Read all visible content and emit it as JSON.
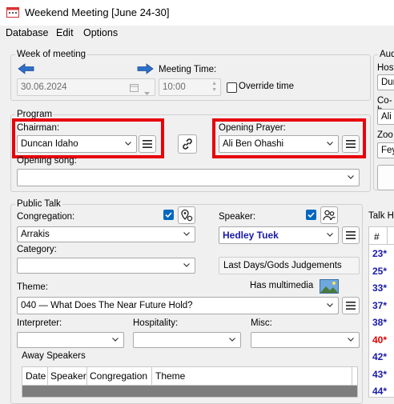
{
  "window": {
    "title": "Weekend Meeting [June 24-30]"
  },
  "menu": [
    "Database",
    "Edit",
    "Options"
  ],
  "week": {
    "group_label": "Week of meeting",
    "date_value": "30.06.2024",
    "meeting_time_label": "Meeting Time:",
    "meeting_time_value": "10:00",
    "override_label": "Override time"
  },
  "audio": {
    "group_label": "Aud",
    "host_label": "Host",
    "host_value": "Dun",
    "cohost_label": "Co-h",
    "cohost_value": "Ali",
    "zoom_label": "Zoo",
    "zoom_value": "Fey"
  },
  "program": {
    "group_label": "Program",
    "chairman_label": "Chairman:",
    "chairman_value": "Duncan Idaho",
    "opening_prayer_label": "Opening Prayer:",
    "opening_prayer_value": "Ali Ben Ohashi",
    "opening_song_label": "Opening song:",
    "opening_song_value": ""
  },
  "public_talk": {
    "group_label": "Public Talk",
    "congregation_label": "Congregation:",
    "congregation_value": "Arrakis",
    "category_label": "Category:",
    "category_value": "",
    "speaker_label": "Speaker:",
    "speaker_value": "Hedley Tuek",
    "talk_category_display": "Last Days/Gods Judgements",
    "theme_label": "Theme:",
    "has_multimedia_label": "Has multimedia",
    "theme_value": "040 — What Does The Near Future Hold?",
    "interpreter_label": "Interpreter:",
    "hospitality_label": "Hospitality:",
    "misc_label": "Misc:"
  },
  "away_speakers": {
    "label": "Away Speakers",
    "columns": [
      "Date",
      "Speaker",
      "Congregation",
      "Theme"
    ]
  },
  "talk_history": {
    "label": "Talk His",
    "column": "#",
    "rows": [
      {
        "num": "23*",
        "color": "#1a1aa8"
      },
      {
        "num": "25*",
        "color": "#1a1aa8"
      },
      {
        "num": "33*",
        "color": "#1a1aa8"
      },
      {
        "num": "37*",
        "color": "#1a1aa8"
      },
      {
        "num": "38*",
        "color": "#1a1aa8"
      },
      {
        "num": "40*",
        "color": "#e00000"
      },
      {
        "num": "42*",
        "color": "#1a1aa8"
      },
      {
        "num": "43*",
        "color": "#1a1aa8"
      },
      {
        "num": "44*",
        "color": "#1a1aa8"
      }
    ]
  },
  "colors": {
    "highlight": "#e8000b",
    "accent": "#0067c0",
    "speaker_text": "#1a1aa8"
  }
}
